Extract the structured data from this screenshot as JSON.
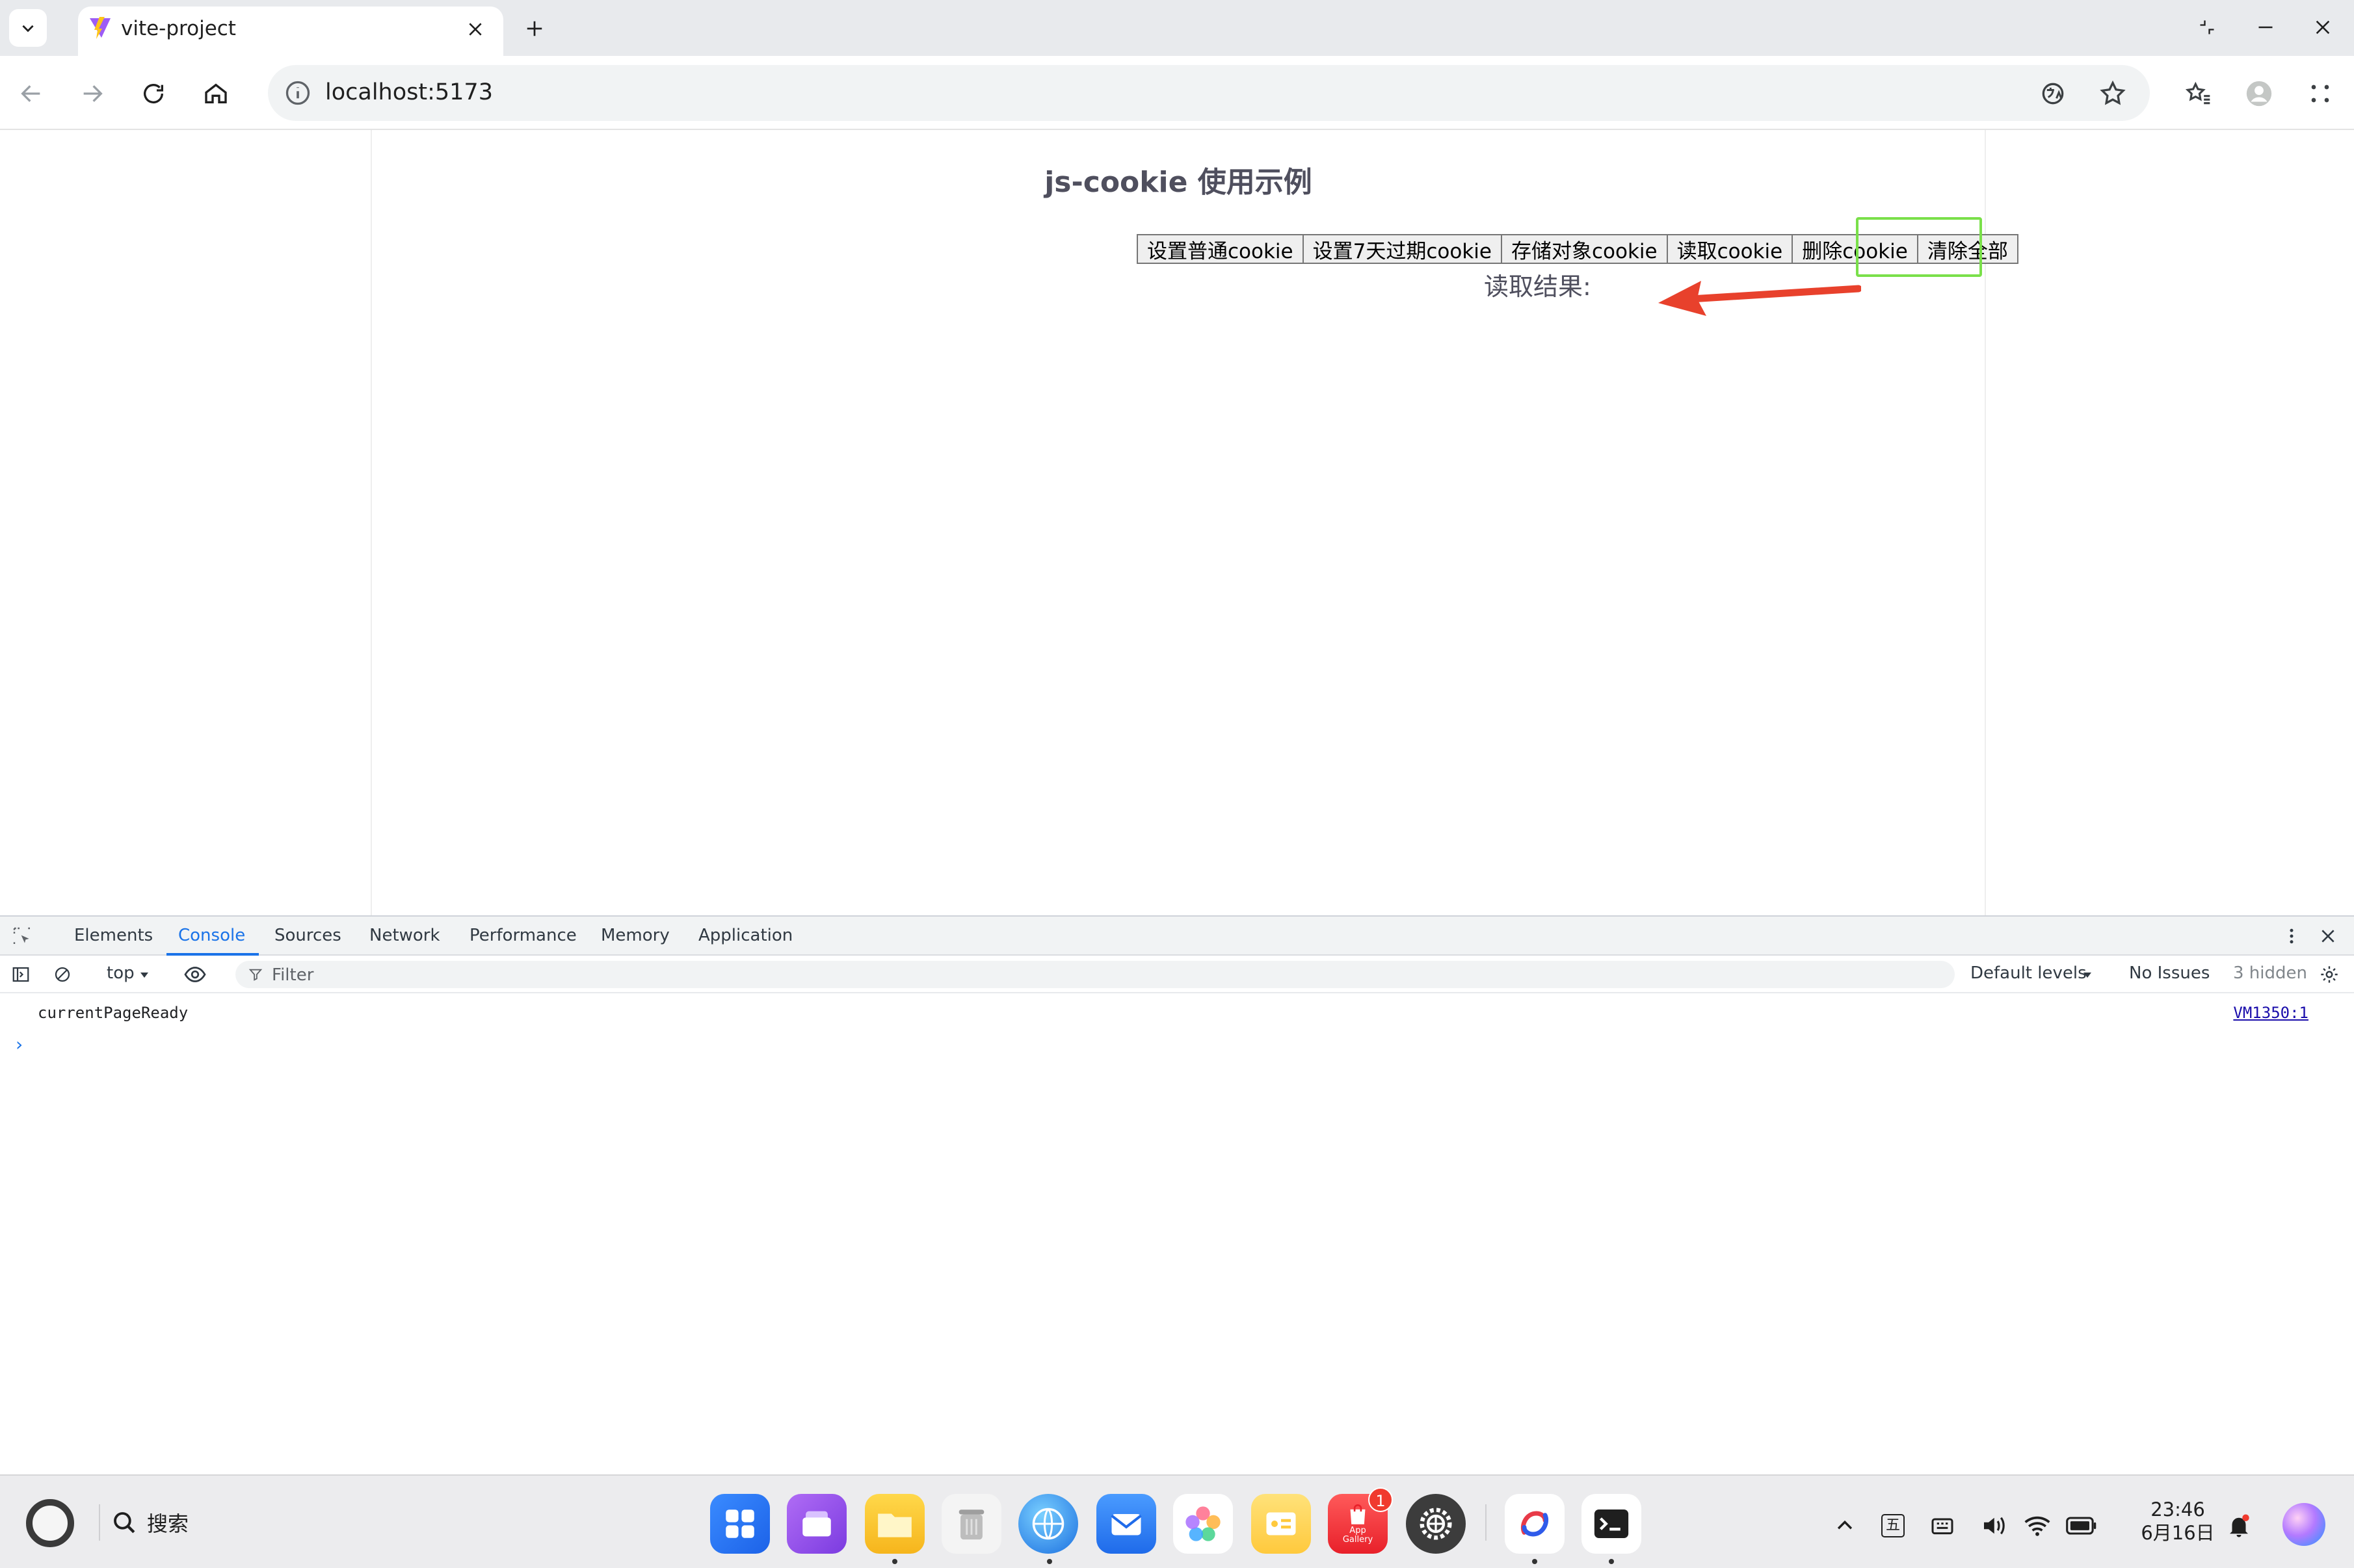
{
  "browser": {
    "tab_title": "vite-project",
    "url": "localhost:5173"
  },
  "page": {
    "title": "js-cookie 使用示例",
    "buttons": [
      "设置普通cookie",
      "设置7天过期cookie",
      "存储对象cookie",
      "读取cookie",
      "删除cookie",
      "清除全部"
    ],
    "result_label": "读取结果:",
    "highlight_color": "#7ae04a",
    "arrow_color": "#e8412c"
  },
  "devtools": {
    "tabs": [
      "Elements",
      "Console",
      "Sources",
      "Network",
      "Performance",
      "Memory",
      "Application"
    ],
    "active_tab": "Console",
    "context": "top",
    "filter_placeholder": "Filter",
    "levels": "Default levels",
    "issues": "No Issues",
    "hidden": "3 hidden",
    "log_message": "currentPageReady",
    "log_source": "VM1350:1",
    "prompt": "›"
  },
  "taskbar": {
    "search_label": "搜索",
    "app_gallery_label": "App Gallery",
    "app_gallery_badge": "1",
    "input_method": "五",
    "time": "23:46",
    "date": "6月16日"
  }
}
